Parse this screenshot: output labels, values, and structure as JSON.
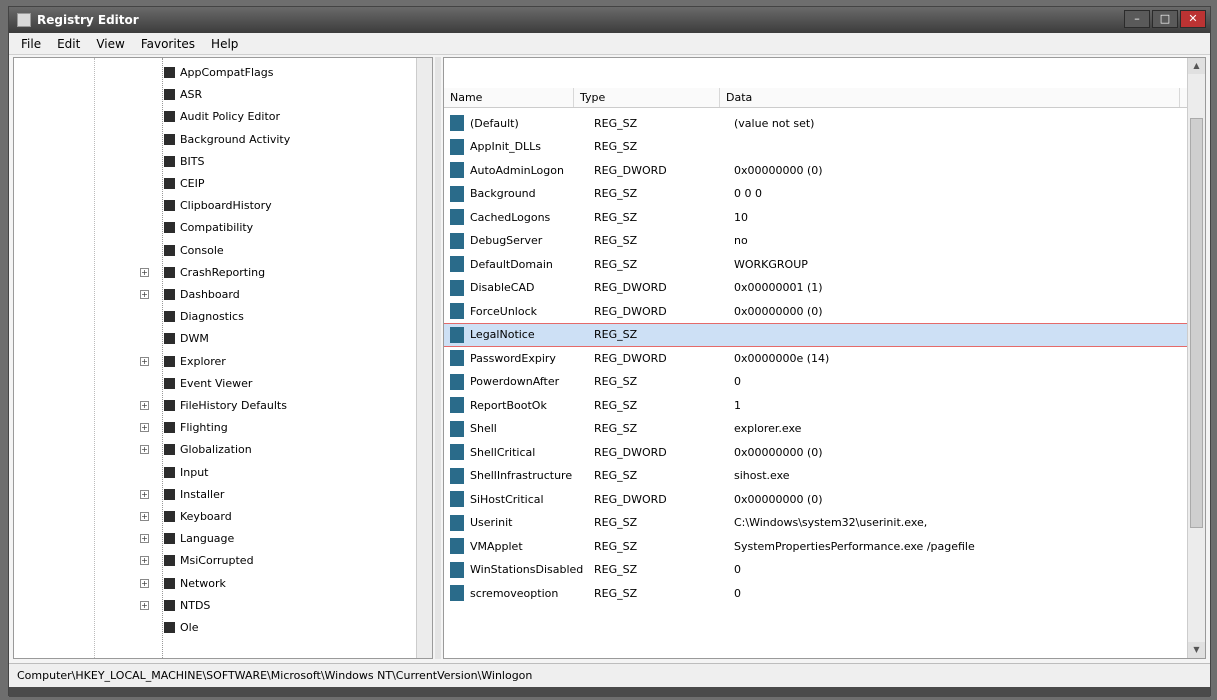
{
  "window": {
    "title": "Registry Editor",
    "controls": {
      "minimize": "–",
      "maximize": "□",
      "close": "✕"
    }
  },
  "menubar": {
    "items": [
      "File",
      "Edit",
      "View",
      "Favorites",
      "Help"
    ]
  },
  "tree": {
    "items": [
      {
        "label": "AppCompatFlags",
        "expander": ""
      },
      {
        "label": "ASR",
        "expander": ""
      },
      {
        "label": "Audit Policy Editor",
        "expander": ""
      },
      {
        "label": "Background Activity",
        "expander": ""
      },
      {
        "label": "BITS",
        "expander": ""
      },
      {
        "label": "CEIP",
        "expander": ""
      },
      {
        "label": "ClipboardHistory",
        "expander": ""
      },
      {
        "label": "Compatibility",
        "expander": ""
      },
      {
        "label": "Console",
        "expander": ""
      },
      {
        "label": "CrashReporting",
        "expander": "+"
      },
      {
        "label": "Dashboard",
        "expander": "+"
      },
      {
        "label": "Diagnostics",
        "expander": ""
      },
      {
        "label": "DWM",
        "expander": ""
      },
      {
        "label": "Explorer",
        "expander": "+"
      },
      {
        "label": "Event Viewer",
        "expander": ""
      },
      {
        "label": "FileHistory Defaults",
        "expander": "+"
      },
      {
        "label": "Flighting",
        "expander": "+"
      },
      {
        "label": "Globalization",
        "expander": "+"
      },
      {
        "label": "Input",
        "expander": ""
      },
      {
        "label": "Installer",
        "expander": "+"
      },
      {
        "label": "Keyboard",
        "expander": "+"
      },
      {
        "label": "Language",
        "expander": "+"
      },
      {
        "label": "MsiCorrupted",
        "expander": "+"
      },
      {
        "label": "Network",
        "expander": "+"
      },
      {
        "label": "NTDS",
        "expander": "+"
      },
      {
        "label": "Ole",
        "expander": ""
      }
    ]
  },
  "list": {
    "columns": {
      "name": "Name",
      "type": "Type",
      "data": "Data"
    },
    "rows": [
      {
        "name": "(Default)",
        "type": "REG_SZ",
        "data": "(value not set)"
      },
      {
        "name": "AppInit_DLLs",
        "type": "REG_SZ",
        "data": ""
      },
      {
        "name": "AutoAdminLogon",
        "type": "REG_DWORD",
        "data": "0x00000000 (0)"
      },
      {
        "name": "Background",
        "type": "REG_SZ",
        "data": "0 0 0"
      },
      {
        "name": "CachedLogons",
        "type": "REG_SZ",
        "data": "10"
      },
      {
        "name": "DebugServer",
        "type": "REG_SZ",
        "data": "no"
      },
      {
        "name": "DefaultDomain",
        "type": "REG_SZ",
        "data": "WORKGROUP"
      },
      {
        "name": "DisableCAD",
        "type": "REG_DWORD",
        "data": "0x00000001 (1)"
      },
      {
        "name": "ForceUnlock",
        "type": "REG_DWORD",
        "data": "0x00000000 (0)"
      },
      {
        "name": "LegalNotice",
        "type": "REG_SZ",
        "data": ""
      },
      {
        "name": "PasswordExpiry",
        "type": "REG_DWORD",
        "data": "0x0000000e (14)"
      },
      {
        "name": "PowerdownAfter",
        "type": "REG_SZ",
        "data": "0"
      },
      {
        "name": "ReportBootOk",
        "type": "REG_SZ",
        "data": "1"
      },
      {
        "name": "Shell",
        "type": "REG_SZ",
        "data": "explorer.exe"
      },
      {
        "name": "ShellCritical",
        "type": "REG_DWORD",
        "data": "0x00000000 (0)"
      },
      {
        "name": "ShellInfrastructure",
        "type": "REG_SZ",
        "data": "sihost.exe"
      },
      {
        "name": "SiHostCritical",
        "type": "REG_DWORD",
        "data": "0x00000000 (0)"
      },
      {
        "name": "Userinit",
        "type": "REG_SZ",
        "data": "C:\\Windows\\system32\\userinit.exe,"
      },
      {
        "name": "VMApplet",
        "type": "REG_SZ",
        "data": "SystemPropertiesPerformance.exe /pagefile"
      },
      {
        "name": "WinStationsDisabled",
        "type": "REG_SZ",
        "data": "0"
      },
      {
        "name": "scremoveoption",
        "type": "REG_SZ",
        "data": "0"
      }
    ]
  },
  "statusbar": {
    "path": "Computer\\HKEY_LOCAL_MACHINE\\SOFTWARE\\Microsoft\\Windows NT\\CurrentVersion\\Winlogon"
  },
  "colors": {
    "selection": "#cde0f5",
    "selection_outline": "#e46a6a",
    "title_bar": "#3c3c3c",
    "value_icon": "#2a6b8a"
  }
}
